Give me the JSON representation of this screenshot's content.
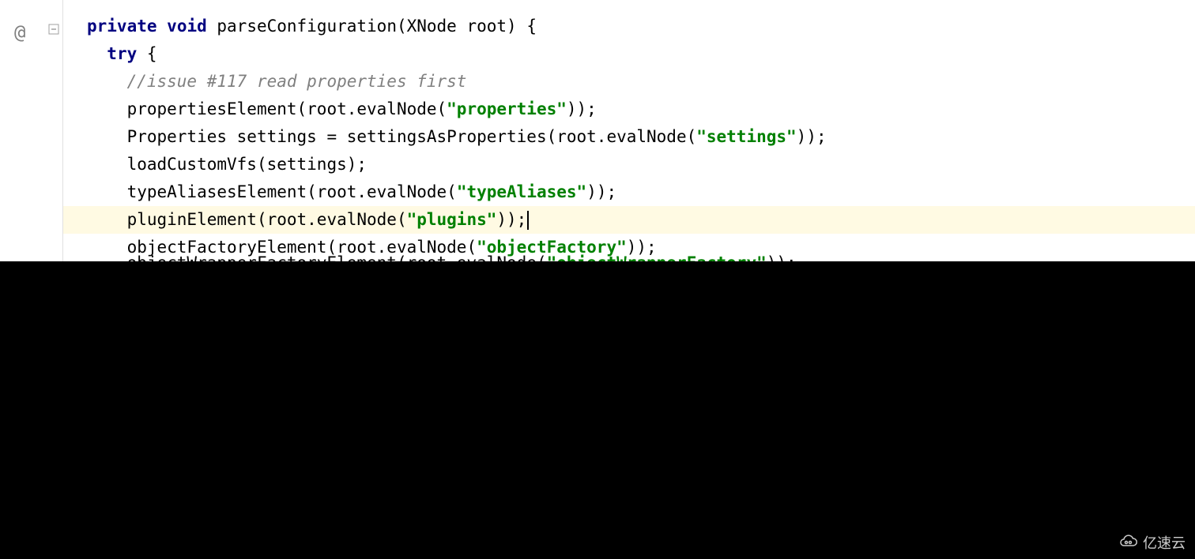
{
  "gutter": {
    "override_marker": "@"
  },
  "code": {
    "keywords": {
      "private": "private",
      "void": "void",
      "try": "try"
    },
    "method_signature": " parseConfiguration(XNode root) {",
    "try_brace": " {",
    "comment": "//issue #117 read properties first",
    "lines": {
      "properties_call": "propertiesElement(root.evalNode(",
      "properties_str": "\"properties\"",
      "properties_end": "));",
      "settings_decl": "Properties settings = settingsAsProperties(root.evalNode(",
      "settings_str": "\"settings\"",
      "settings_end": "));",
      "loadvfs": "loadCustomVfs(settings);",
      "typealiases_call": "typeAliasesElement(root.evalNode(",
      "typealiases_str": "\"typeAliases\"",
      "typealiases_end": "));",
      "plugin_call": "pluginElement(root.evalNode(",
      "plugin_str": "\"plugins\"",
      "plugin_end": "));",
      "objfactory_call": "objectFactoryElement(root.evalNode(",
      "objfactory_str": "\"objectFactory\"",
      "objfactory_end": "));",
      "objwrapper_call": "objectWrapperFactoryElement(root.evalNode(",
      "objwrapper_str": "\"objectWrapperFactory\"",
      "objwrapper_end": "));"
    }
  },
  "watermark": {
    "text": "亿速云"
  }
}
